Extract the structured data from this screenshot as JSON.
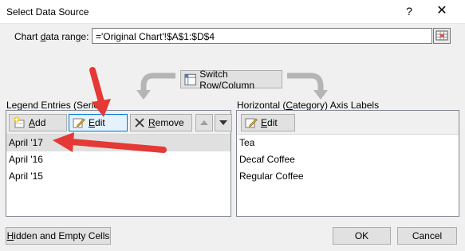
{
  "window": {
    "title": "Select Data Source",
    "help_glyph": "?",
    "close_glyph": "✕"
  },
  "range": {
    "label_pre": "Chart ",
    "label_mnemonic": "d",
    "label_post": "ata range:",
    "value": "='Original Chart'!$A$1:$D$4"
  },
  "switch": {
    "label_mnemonic": "W",
    "label_post": "Switch Row/Column"
  },
  "legend": {
    "title": "Legend Entries (Series)",
    "buttons": {
      "add_mnemonic": "A",
      "add_post": "dd",
      "edit_mnemonic": "E",
      "edit_post": "dit",
      "remove_mnemonic": "R",
      "remove_post": "emove"
    },
    "items": [
      "April '17",
      "April '16",
      "April '15"
    ]
  },
  "axis": {
    "title_pre": "Horizontal (",
    "title_mnemonic": "C",
    "title_post": "ategory) Axis Labels",
    "edit_mnemonic": "E",
    "edit_post": "dit",
    "items": [
      "Tea",
      "Decaf Coffee",
      "Regular Coffee"
    ]
  },
  "footer": {
    "hidden_mnemonic": "H",
    "hidden_post": "idden and Empty Cells",
    "ok": "OK",
    "cancel": "Cancel"
  },
  "colors": {
    "annotation_arrow": "#e53935",
    "edit_focus": "#0078d7"
  }
}
